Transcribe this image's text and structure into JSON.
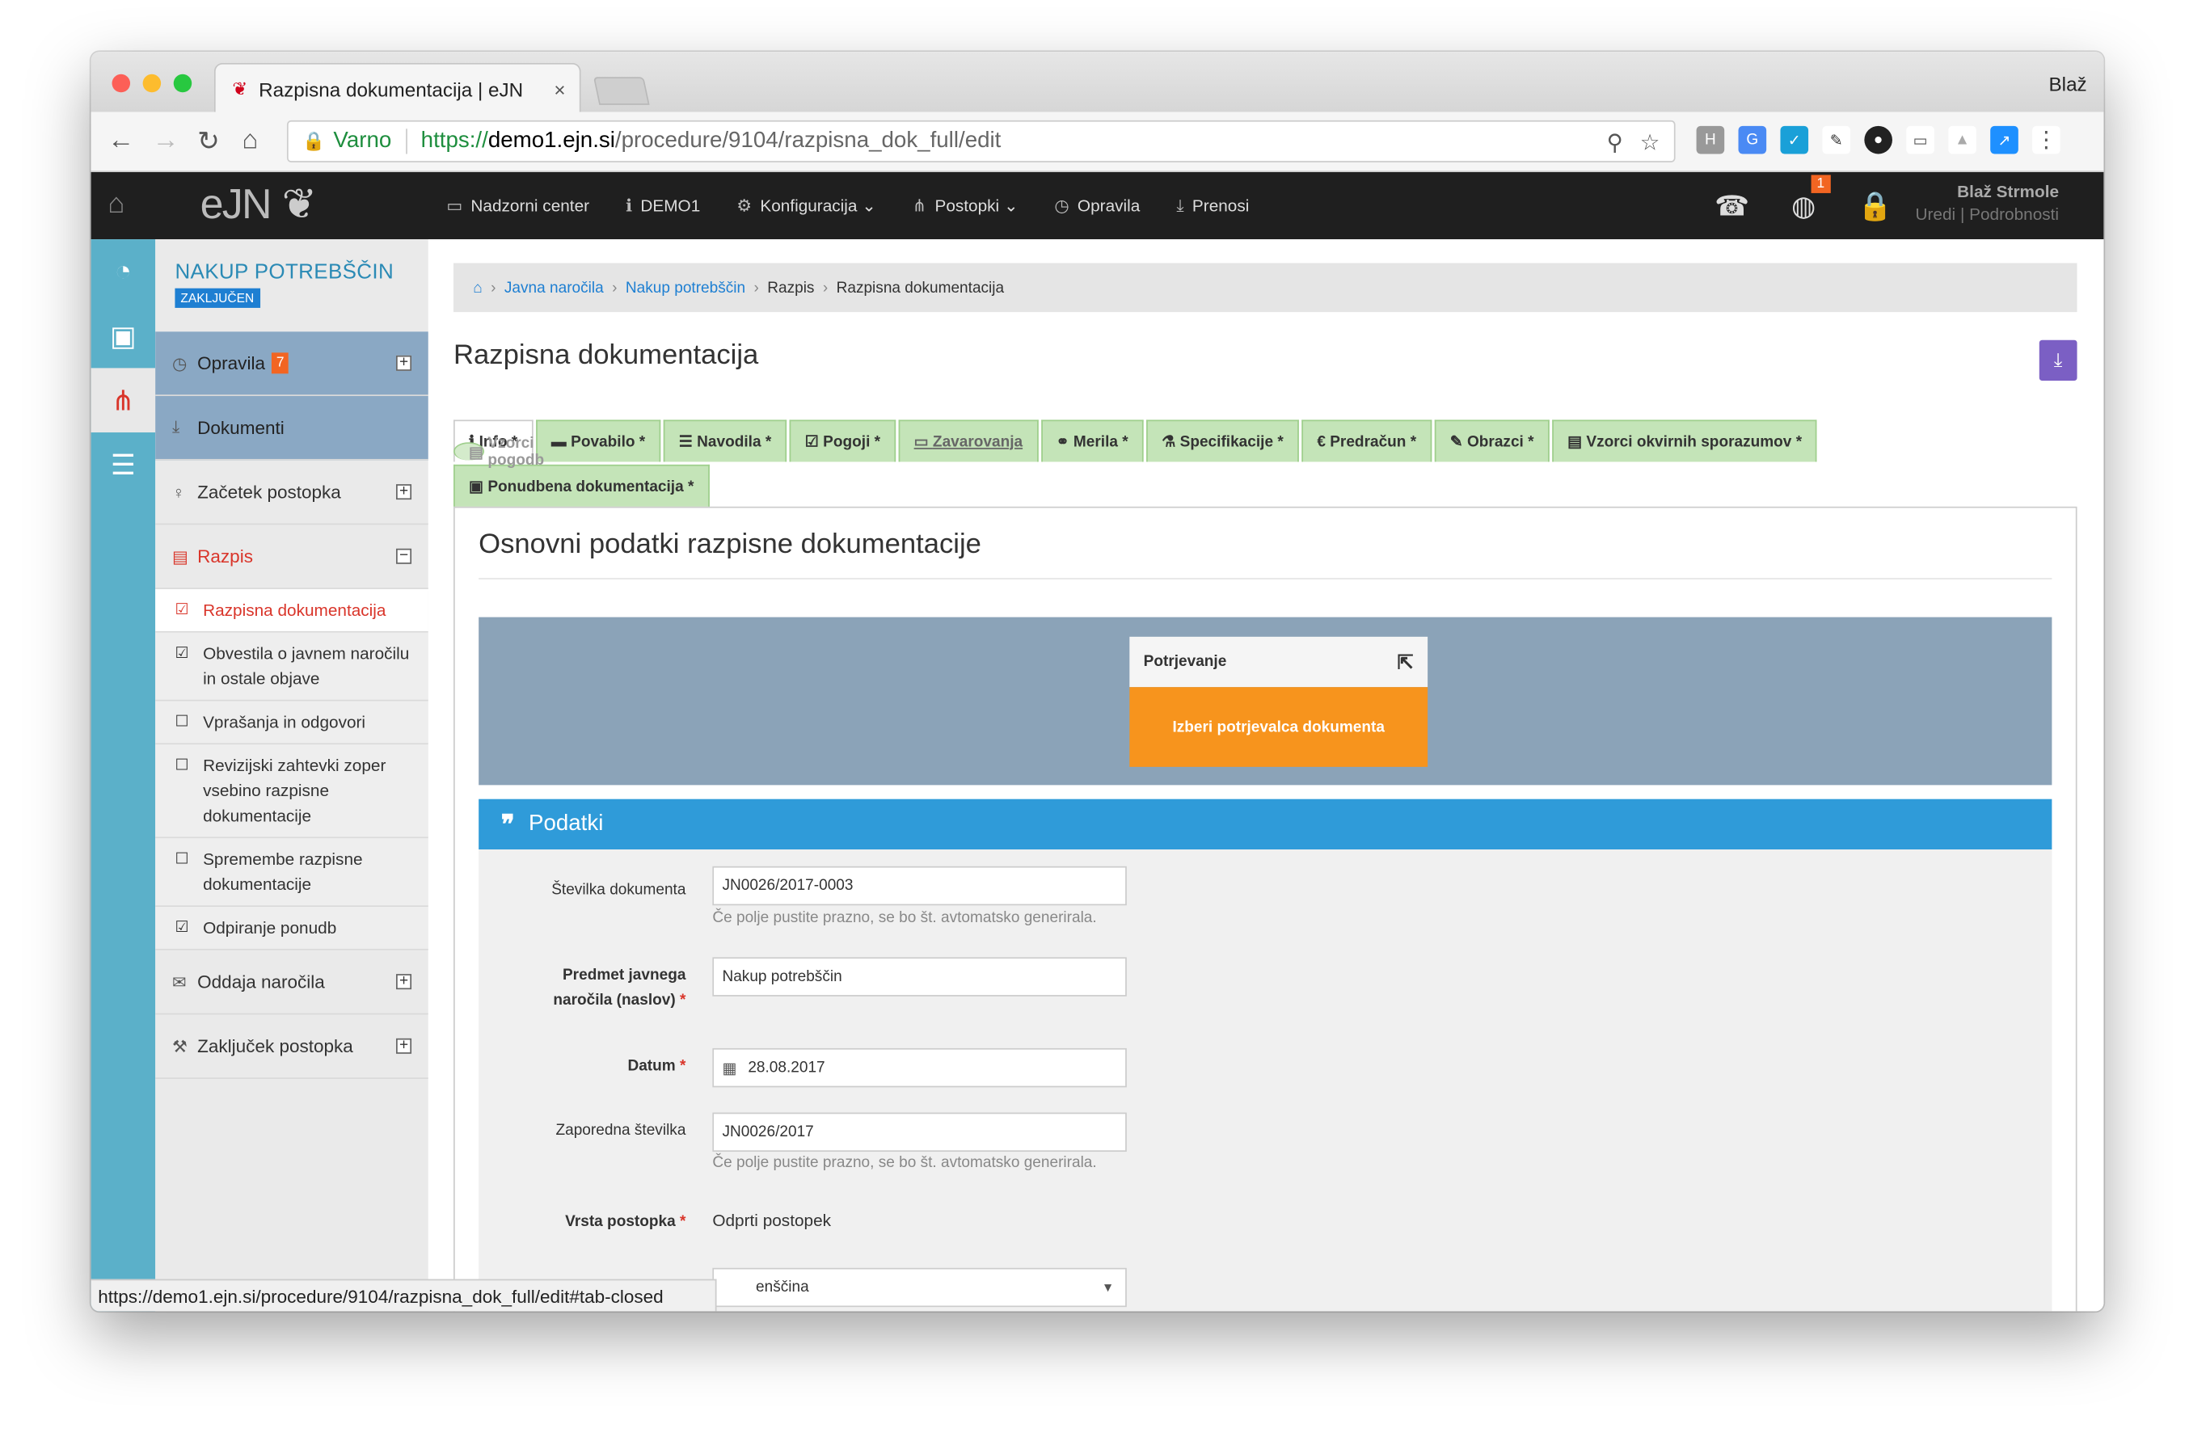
{
  "browser": {
    "tab_title": "Razpisna dokumentacija | eJN",
    "user": "Blaž",
    "secure_label": "Varno",
    "url_scheme": "https://",
    "url_host": "demo1.ejn.si",
    "url_path": "/procedure/9104/razpisna_dok_full/edit",
    "status_url": "https://demo1.ejn.si/procedure/9104/razpisna_dok_full/edit#tab-closed"
  },
  "topnav": {
    "logo": "eJN",
    "items": [
      {
        "icon": "monitor-icon",
        "label": "Nadzorni center"
      },
      {
        "icon": "info-icon",
        "label": "DEMO1"
      },
      {
        "icon": "cogs-icon",
        "label": "Konfiguracija"
      },
      {
        "icon": "sitemap-icon",
        "label": "Postopki"
      },
      {
        "icon": "clock-icon",
        "label": "Opravila"
      },
      {
        "icon": "download-icon",
        "label": "Prenosi"
      }
    ],
    "notif_count": "1",
    "user_name": "Blaž Strmole",
    "user_edit": "Uredi",
    "user_details": "Podrobnosti"
  },
  "sidebar": {
    "title": "NAKUP POTREBŠČIN",
    "status": "ZAKLJUČEN",
    "items": [
      {
        "label": "Opravila",
        "badge": "7"
      },
      {
        "label": "Dokumenti"
      },
      {
        "label": "Začetek postopka"
      },
      {
        "label": "Razpis"
      },
      {
        "label": "Oddaja naročila"
      },
      {
        "label": "Zaključek postopka"
      }
    ],
    "subitems": [
      "Razpisna dokumentacija",
      "Obvestila o javnem naročilu in ostale objave",
      "Vprašanja in odgovori",
      "Revizijski zahtevki zoper vsebino razpisne dokumentacije",
      "Spremembe razpisne dokumentacije",
      "Odpiranje ponudb"
    ]
  },
  "breadcrumb": {
    "items": [
      "Javna naročila",
      "Nakup potrebščin",
      "Razpis",
      "Razpisna dokumentacija"
    ]
  },
  "page_title": "Razpisna dokumentacija",
  "tabs": [
    "Info *",
    "Povabilo *",
    "Navodila *",
    "Pogoji *",
    "Zavarovanja",
    "Merila *",
    "Specifikacije *",
    "Predračun *",
    "Obrazci *",
    "Vzorci okvirnih sporazumov *",
    "Vzorci pogodb",
    "Ponudbena dokumentacija *"
  ],
  "section_title": "Osnovni podatki razpisne dokumentacije",
  "approval": {
    "title": "Potrjevanje",
    "button": "Izberi potrjevalca dokumenta"
  },
  "panel_title": "Podatki",
  "form": {
    "doc_number_label": "Številka dokumenta",
    "doc_number_value": "JN0026/2017-0003",
    "help": "Če polje pustite prazno, se bo št. avtomatsko generirala.",
    "subject_label_1": "Predmet javnega",
    "subject_label_2": "naročila (naslov)",
    "subject_value": "Nakup potrebščin",
    "date_label": "Datum",
    "date_value": "28.08.2017",
    "seq_label": "Zaporedna številka",
    "seq_value": "JN0026/2017",
    "type_label": "Vrsta postopka",
    "type_value": "Odprti postopek",
    "lang_value": "enščina"
  }
}
